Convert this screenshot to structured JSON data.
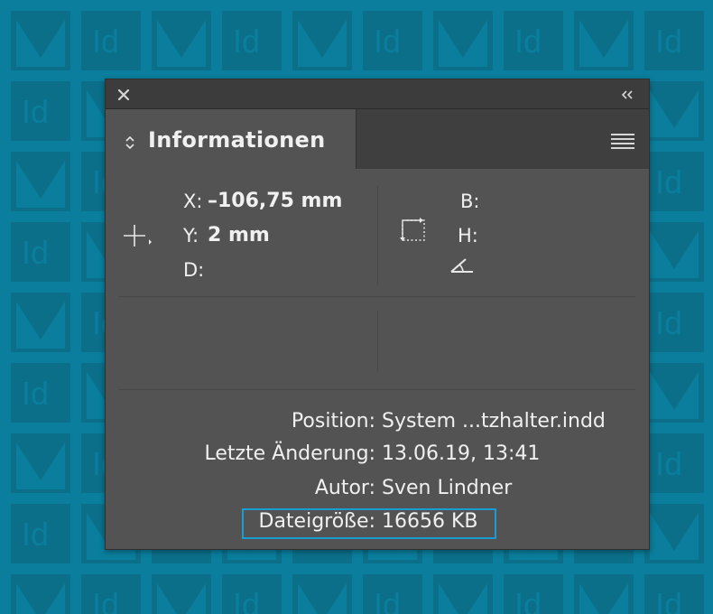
{
  "colors": {
    "background": "#0a7e9c",
    "panel": "#535353",
    "highlight": "#1a9ed1"
  },
  "background": {
    "tile_icon": "indesign-logo-icon",
    "tile_text": "Id"
  },
  "panel": {
    "close_icon": "close-icon",
    "collapse_icon": "double-chevron-left-icon",
    "tab_title": "Informationen",
    "menu_icon": "hamburger-menu-icon"
  },
  "coords": {
    "x_label": "X:",
    "x_value": "–106,75 mm",
    "y_label": "Y:",
    "y_value": "2 mm",
    "d_label": "D:",
    "b_label": "B:",
    "h_label": "H:"
  },
  "file_info": {
    "position_label": "Position:",
    "position_value": "System ...tzhalter.indd",
    "modified_label": "Letzte Änderung:",
    "modified_value": "13.06.19, 13:41",
    "author_label": "Autor:",
    "author_value": "Sven Lindner",
    "size_label": "Dateigröße:",
    "size_value": "16656 KB"
  }
}
